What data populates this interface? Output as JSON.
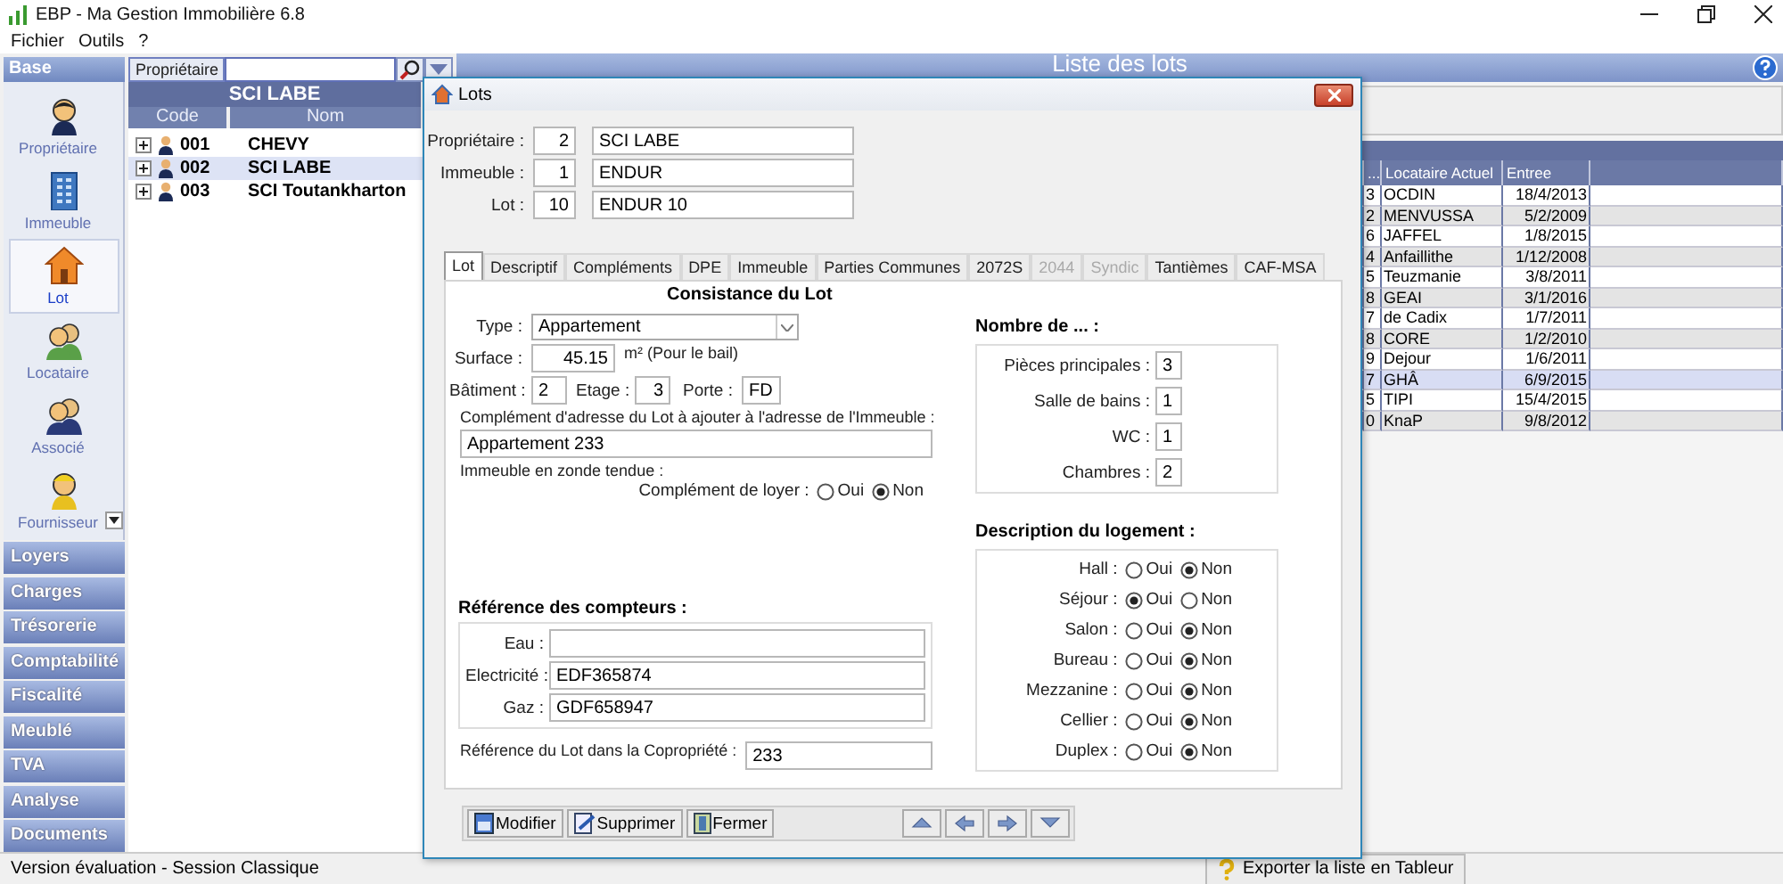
{
  "window": {
    "title": "EBP - Ma Gestion Immobilière 6.8"
  },
  "menu": [
    "Fichier",
    "Outils",
    "?"
  ],
  "sidebar": {
    "header": "Base",
    "items": [
      {
        "label": "Propriétaire",
        "selected": false
      },
      {
        "label": "Immeuble",
        "selected": false
      },
      {
        "label": "Lot",
        "selected": true
      },
      {
        "label": "Locataire",
        "selected": false
      },
      {
        "label": "Associé",
        "selected": false
      },
      {
        "label": "Fournisseur",
        "selected": false
      }
    ],
    "groups": [
      "Loyers",
      "Charges",
      "Trésorerie",
      "Comptabilité",
      "Fiscalité",
      "Meublé",
      "TVA",
      "Analyse",
      "Documents"
    ]
  },
  "owner_panel": {
    "search_label": "Propriétaire",
    "title": "SCI LABE",
    "columns": [
      "Code",
      "Nom"
    ],
    "rows": [
      {
        "code": "001",
        "name": "CHEVY",
        "selected": false
      },
      {
        "code": "002",
        "name": "SCI LABE",
        "selected": true
      },
      {
        "code": "003",
        "name": "SCI Toutankharton",
        "selected": false
      }
    ]
  },
  "list": {
    "title": "Liste des lots",
    "columns": [
      "...",
      "Locataire Actuel",
      "Entree"
    ],
    "rows": [
      {
        "cells": [
          "3",
          "OCDIN",
          "18/4/2013"
        ],
        "selected": false
      },
      {
        "cells": [
          "2",
          "MENVUSSA",
          "5/2/2009"
        ],
        "selected": false
      },
      {
        "cells": [
          "6",
          "JAFFEL",
          "1/8/2015"
        ],
        "selected": false
      },
      {
        "cells": [
          "4",
          "Anfaillithe",
          "1/12/2008"
        ],
        "selected": false
      },
      {
        "cells": [
          "5",
          "Teuzmanie",
          "3/8/2011"
        ],
        "selected": false
      },
      {
        "cells": [
          "8",
          "GEAI",
          "3/1/2016"
        ],
        "selected": false
      },
      {
        "cells": [
          "7",
          "de Cadix",
          "1/7/2011"
        ],
        "selected": false
      },
      {
        "cells": [
          "8",
          "CORE",
          "1/2/2010"
        ],
        "selected": false
      },
      {
        "cells": [
          "9",
          "Dejour",
          "1/6/2011"
        ],
        "selected": false
      },
      {
        "cells": [
          "7",
          "GHÂ",
          "6/9/2015"
        ],
        "selected": true
      },
      {
        "cells": [
          "5",
          "TIPI",
          "15/4/2015"
        ],
        "selected": false
      },
      {
        "cells": [
          "0",
          "KnaP",
          "9/8/2012"
        ],
        "selected": false
      }
    ]
  },
  "dialog": {
    "title": "Lots",
    "header_fields": [
      {
        "label": "Propriétaire :",
        "code": "2",
        "name": "SCI LABE"
      },
      {
        "label": "Immeuble :",
        "code": "1",
        "name": "ENDUR"
      },
      {
        "label": "Lot :",
        "code": "10",
        "name": "ENDUR 10"
      }
    ],
    "tabs": [
      {
        "label": "Lot",
        "selected": true,
        "disabled": false
      },
      {
        "label": "Descriptif",
        "selected": false,
        "disabled": false
      },
      {
        "label": "Compléments",
        "selected": false,
        "disabled": false
      },
      {
        "label": "DPE",
        "selected": false,
        "disabled": false
      },
      {
        "label": "Immeuble",
        "selected": false,
        "disabled": false
      },
      {
        "label": "Parties Communes",
        "selected": false,
        "disabled": false
      },
      {
        "label": "2072S",
        "selected": false,
        "disabled": false
      },
      {
        "label": "2044",
        "selected": false,
        "disabled": true
      },
      {
        "label": "Syndic",
        "selected": false,
        "disabled": true
      },
      {
        "label": "Tantièmes",
        "selected": false,
        "disabled": false
      },
      {
        "label": "CAF-MSA",
        "selected": false,
        "disabled": false
      }
    ],
    "section_title": "Consistance du Lot",
    "type": {
      "label": "Type :",
      "value": "Appartement"
    },
    "surface": {
      "label": "Surface :",
      "value": "45.15",
      "unit": "m² (Pour le bail)"
    },
    "batiment": {
      "label": "Bâtiment :",
      "value": "2"
    },
    "etage": {
      "label": "Etage :",
      "value": "3"
    },
    "porte": {
      "label": "Porte :",
      "value": "FD"
    },
    "address": {
      "label": "Complément d'adresse du Lot à ajouter à l'adresse de l'Immeuble :",
      "value": "Appartement 233"
    },
    "zone_label": "Immeuble en zonde tendue :",
    "rent_complement": {
      "label": "Complément de loyer :",
      "options": [
        {
          "label": "Oui",
          "selected": false
        },
        {
          "label": "Non",
          "selected": true
        }
      ]
    },
    "meters": {
      "title": "Référence des compteurs :",
      "rows": [
        {
          "label": "Eau :"
        },
        {
          "label": "Electricité :",
          "value": "EDF365874"
        },
        {
          "label": "Gaz :",
          "value": "GDF658947"
        }
      ]
    },
    "copro": {
      "label": "Référence du Lot dans la Copropriété :",
      "value": "233"
    },
    "counts": {
      "title": "Nombre de ... :",
      "rows": [
        {
          "label": "Pièces principales :",
          "value": "3"
        },
        {
          "label": "Salle de bains :",
          "value": "1"
        },
        {
          "label": "WC :",
          "value": "1"
        },
        {
          "label": "Chambres :",
          "value": "2"
        }
      ]
    },
    "description": {
      "title": "Description du logement :",
      "rows": [
        {
          "label": "Hall :",
          "options": [
            {
              "label": "Oui",
              "selected": false
            },
            {
              "label": "Non",
              "selected": true
            }
          ]
        },
        {
          "label": "Séjour :",
          "options": [
            {
              "label": "Oui",
              "selected": true
            },
            {
              "label": "Non",
              "selected": false
            }
          ]
        },
        {
          "label": "Salon :",
          "options": [
            {
              "label": "Oui",
              "selected": false
            },
            {
              "label": "Non",
              "selected": true
            }
          ]
        },
        {
          "label": "Bureau :",
          "options": [
            {
              "label": "Oui",
              "selected": false
            },
            {
              "label": "Non",
              "selected": true
            }
          ]
        },
        {
          "label": "Mezzanine :",
          "options": [
            {
              "label": "Oui",
              "selected": false
            },
            {
              "label": "Non",
              "selected": true
            }
          ]
        },
        {
          "label": "Cellier :",
          "options": [
            {
              "label": "Oui",
              "selected": false
            },
            {
              "label": "Non",
              "selected": true
            }
          ]
        },
        {
          "label": "Duplex :",
          "options": [
            {
              "label": "Oui",
              "selected": false
            },
            {
              "label": "Non",
              "selected": true
            }
          ]
        }
      ]
    },
    "buttons": [
      "Modifier",
      "Supprimer",
      "Fermer"
    ]
  },
  "status_bar": {
    "text": "Version évaluation - Session Classique",
    "export_button": "Exporter la liste en Tableur"
  }
}
